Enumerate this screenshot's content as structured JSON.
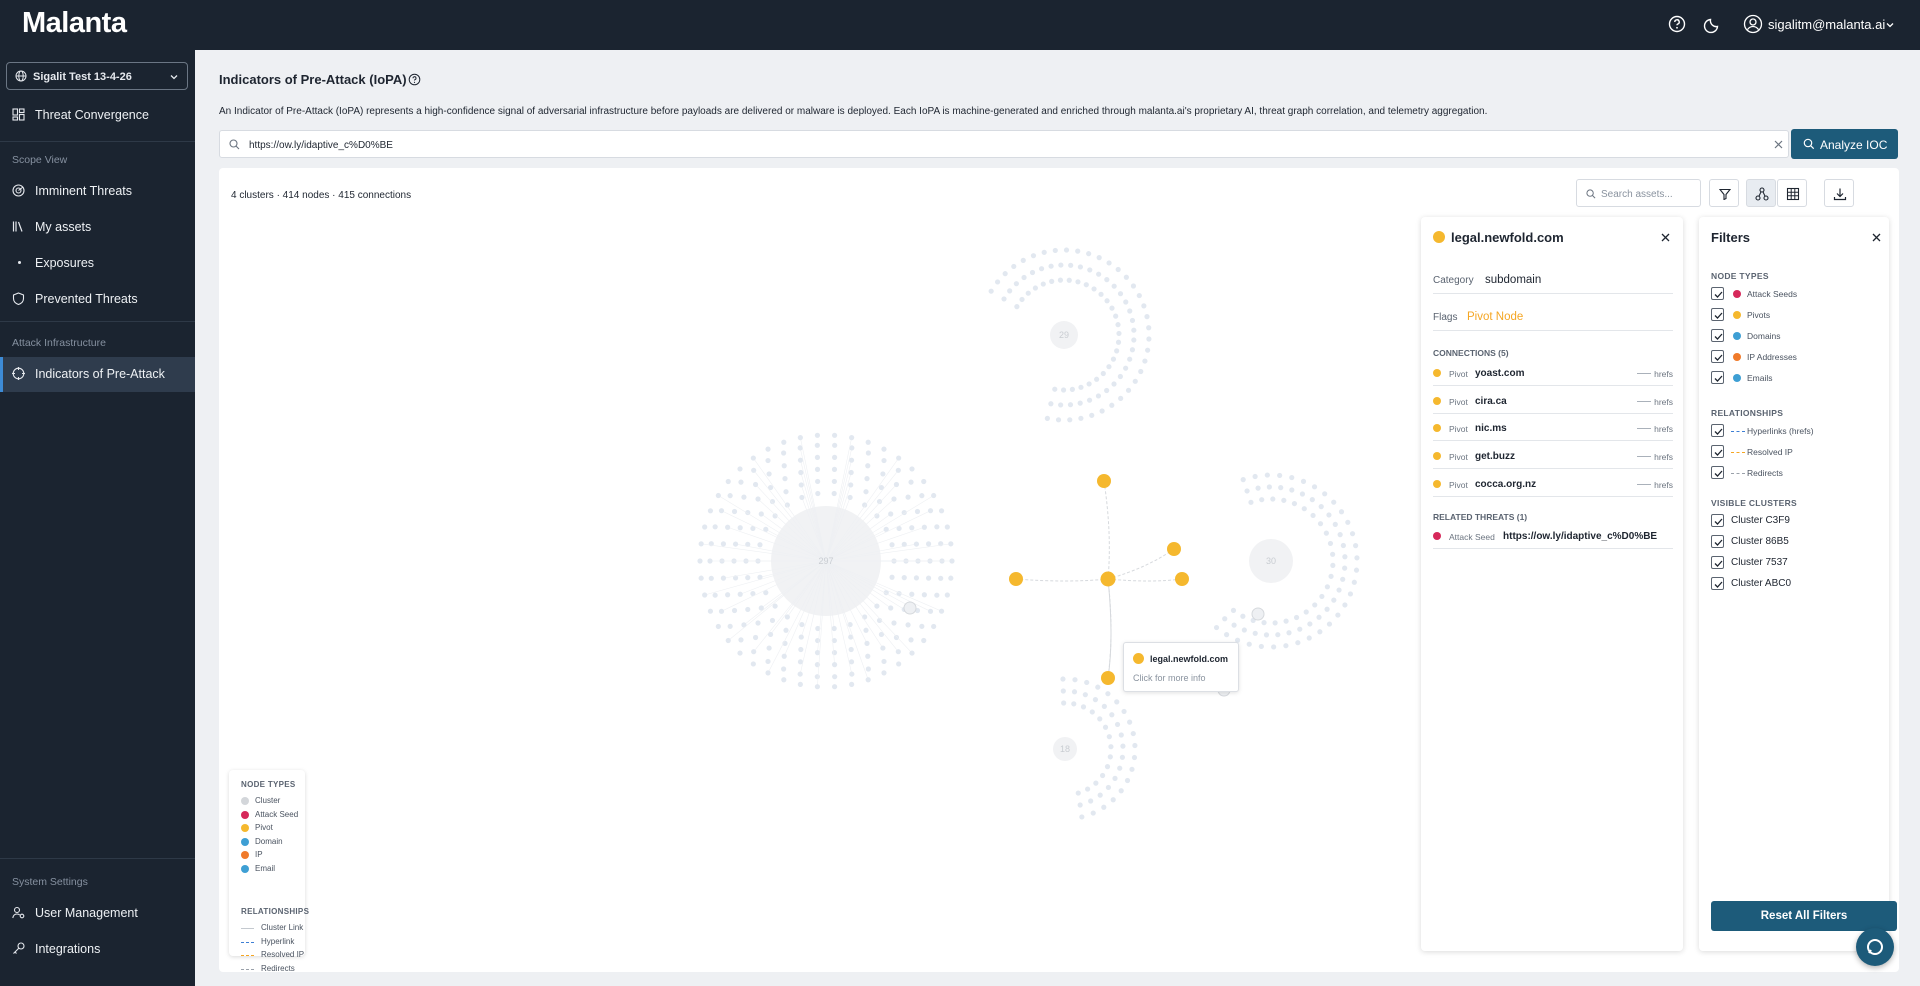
{
  "app": {
    "logo": "Malanta",
    "user_email": "sigalitm@malanta.ai"
  },
  "sidebar": {
    "tenant": "Sigalit Test 13-4-26",
    "threat_convergence": "Threat Convergence",
    "scope_view": "Scope View",
    "imminent_threats": "Imminent Threats",
    "my_assets": "My assets",
    "exposures": "Exposures",
    "prevented_threats": "Prevented Threats",
    "attack_infrastructure": "Attack Infrastructure",
    "indicators": "Indicators of Pre-Attack",
    "system_settings": "System Settings",
    "user_management": "User Management",
    "integrations": "Integrations"
  },
  "page": {
    "title": "Indicators of Pre-Attack (IoPA)",
    "description": "An Indicator of Pre-Attack (IoPA) represents a high-confidence signal of adversarial infrastructure before payloads are delivered or malware is deployed. Each IoPA is machine-generated and enriched through malanta.ai's proprietary AI, threat graph correlation, and telemetry aggregation.",
    "search_value": "https://ow.ly/idaptive_c%D0%BE",
    "analyze_label": "Analyze IOC"
  },
  "graph": {
    "stats": "4 clusters · 414 nodes · 415 connections",
    "asset_search_placeholder": "Search assets...",
    "cluster_labels": [
      "29",
      "297",
      "30",
      "18"
    ],
    "tooltip": {
      "title": "legal.newfold.com",
      "hint": "Click for more info"
    }
  },
  "legend": {
    "node_types_heading": "NODE TYPES",
    "node_types": [
      {
        "label": "Cluster",
        "color": "#d3d6da"
      },
      {
        "label": "Attack Seed",
        "color": "#d6285a"
      },
      {
        "label": "Pivot",
        "color": "#f5b82e"
      },
      {
        "label": "Domain",
        "color": "#3e9fd4"
      },
      {
        "label": "IP",
        "color": "#f07a2a"
      },
      {
        "label": "Email",
        "color": "#3e9fd4"
      }
    ],
    "relationships_heading": "RELATIONSHIPS",
    "relationships": [
      {
        "label": "Cluster Link",
        "color": "#c4c9cf"
      },
      {
        "label": "Hyperlink",
        "color": "#3e7fd4"
      },
      {
        "label": "Resolved IP",
        "color": "#f5a623"
      },
      {
        "label": "Redirects",
        "color": "#9aa1aa"
      }
    ]
  },
  "detail": {
    "title": "legal.newfold.com",
    "category_label": "Category",
    "category_value": "subdomain",
    "flags_label": "Flags",
    "flags_value": "Pivot Node",
    "connections_heading": "CONNECTIONS (5)",
    "connections": [
      {
        "kind": "Pivot",
        "name": "yoast.com",
        "rel": "hrefs"
      },
      {
        "kind": "Pivot",
        "name": "cira.ca",
        "rel": "hrefs"
      },
      {
        "kind": "Pivot",
        "name": "nic.ms",
        "rel": "hrefs"
      },
      {
        "kind": "Pivot",
        "name": "get.buzz",
        "rel": "hrefs"
      },
      {
        "kind": "Pivot",
        "name": "cocca.org.nz",
        "rel": "hrefs"
      }
    ],
    "related_heading": "RELATED THREATS (1)",
    "related": [
      {
        "kind": "Attack Seed",
        "name": "https://ow.ly/idaptive_c%D0%BE"
      }
    ]
  },
  "filters": {
    "title": "Filters",
    "node_types_heading": "NODE TYPES",
    "node_types": [
      {
        "label": "Attack Seeds",
        "color": "#d6285a",
        "checked": true
      },
      {
        "label": "Pivots",
        "color": "#f5b82e",
        "checked": true
      },
      {
        "label": "Domains",
        "color": "#3e9fd4",
        "checked": true
      },
      {
        "label": "IP Addresses",
        "color": "#f07a2a",
        "checked": true
      },
      {
        "label": "Emails",
        "color": "#3e9fd4",
        "checked": true
      }
    ],
    "relationships_heading": "RELATIONSHIPS",
    "relationships": [
      {
        "label": "Hyperlinks (hrefs)",
        "color": "#3e7fd4",
        "checked": true
      },
      {
        "label": "Resolved IP",
        "color": "#f5a623",
        "checked": true
      },
      {
        "label": "Redirects",
        "color": "#9aa1aa",
        "checked": true
      }
    ],
    "clusters_heading": "VISIBLE CLUSTERS",
    "clusters": [
      {
        "label": "Cluster C3F9",
        "checked": true
      },
      {
        "label": "Cluster 86B5",
        "checked": true
      },
      {
        "label": "Cluster 7537",
        "checked": true
      },
      {
        "label": "Cluster ABC0",
        "checked": true
      }
    ],
    "reset_label": "Reset All Filters"
  }
}
